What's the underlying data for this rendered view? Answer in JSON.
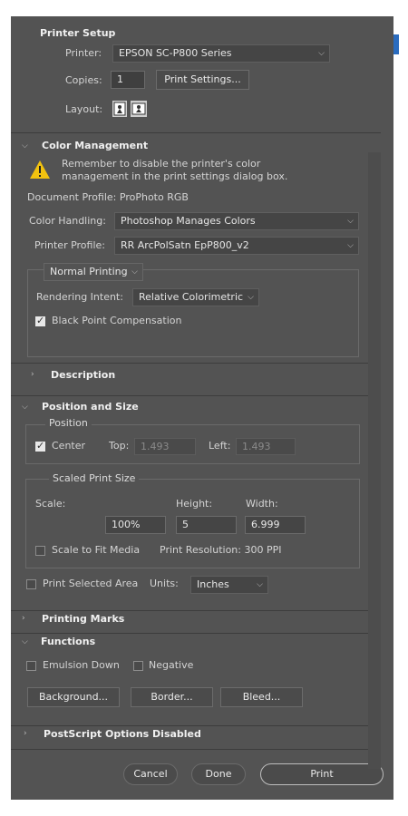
{
  "printer_setup": {
    "title": "Printer Setup",
    "printer_label": "Printer:",
    "printer_value": "EPSON SC-P800 Series",
    "copies_label": "Copies:",
    "copies_value": "1",
    "print_settings_button": "Print Settings...",
    "layout_label": "Layout:"
  },
  "color_management": {
    "title": "Color Management",
    "warning_line1": "Remember to disable the printer's color",
    "warning_line2": "management in the print settings dialog box.",
    "document_profile": "Document Profile: ProPhoto RGB",
    "color_handling_label": "Color Handling:",
    "color_handling_value": "Photoshop Manages Colors",
    "printer_profile_label": "Printer Profile:",
    "printer_profile_value": "RR ArcPolSatn EpP800_v2",
    "mode_value": "Normal Printing",
    "rendering_intent_label": "Rendering Intent:",
    "rendering_intent_value": "Relative Colorimetric",
    "black_point_label": "Black Point Compensation",
    "black_point_checked": true
  },
  "description": {
    "title": "Description"
  },
  "position_size": {
    "title": "Position and Size",
    "position_legend": "Position",
    "center_label": "Center",
    "center_checked": true,
    "top_label": "Top:",
    "top_value": "1.493",
    "left_label": "Left:",
    "left_value": "1.493",
    "scaled_legend": "Scaled Print Size",
    "scale_label": "Scale:",
    "height_label": "Height:",
    "width_label": "Width:",
    "scale_value": "100%",
    "height_value": "5",
    "width_value": "6.999",
    "scale_to_fit_label": "Scale to Fit Media",
    "print_resolution": "Print Resolution: 300 PPI",
    "print_selected_area_label": "Print Selected Area",
    "units_label": "Units:",
    "units_value": "Inches"
  },
  "printing_marks": {
    "title": "Printing Marks"
  },
  "functions": {
    "title": "Functions",
    "emulsion_down_label": "Emulsion Down",
    "negative_label": "Negative",
    "background_button": "Background...",
    "border_button": "Border...",
    "bleed_button": "Bleed..."
  },
  "postscript": {
    "title": "PostScript Options Disabled"
  },
  "footer": {
    "cancel": "Cancel",
    "done": "Done",
    "print": "Print"
  },
  "colors": {
    "panel_bg": "#535353",
    "field_bg": "#454545",
    "accent_blue": "#2a6cbf",
    "warning_yellow": "#f2c20f"
  }
}
